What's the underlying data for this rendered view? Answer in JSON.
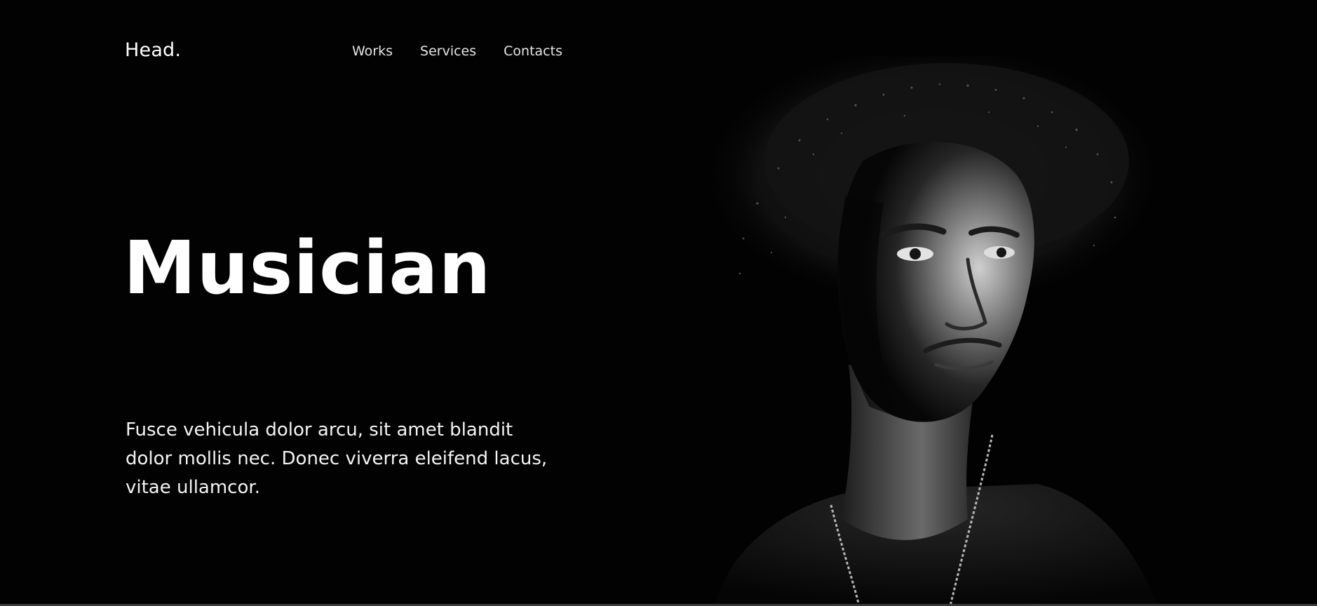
{
  "header": {
    "logo": "Head.",
    "nav": [
      {
        "label": "Works"
      },
      {
        "label": "Services"
      },
      {
        "label": "Contacts"
      }
    ]
  },
  "hero": {
    "title": "Musician",
    "description": "Fusce vehicula dolor arcu, sit amet blandit dolor mollis nec. Donec viverra eleifend lacus, vitae ullamcor."
  },
  "colors": {
    "background": "#020203",
    "text": "#ffffff",
    "nav_text": "#e6e6e8"
  },
  "icons": {
    "portrait": "portrait-photo"
  }
}
